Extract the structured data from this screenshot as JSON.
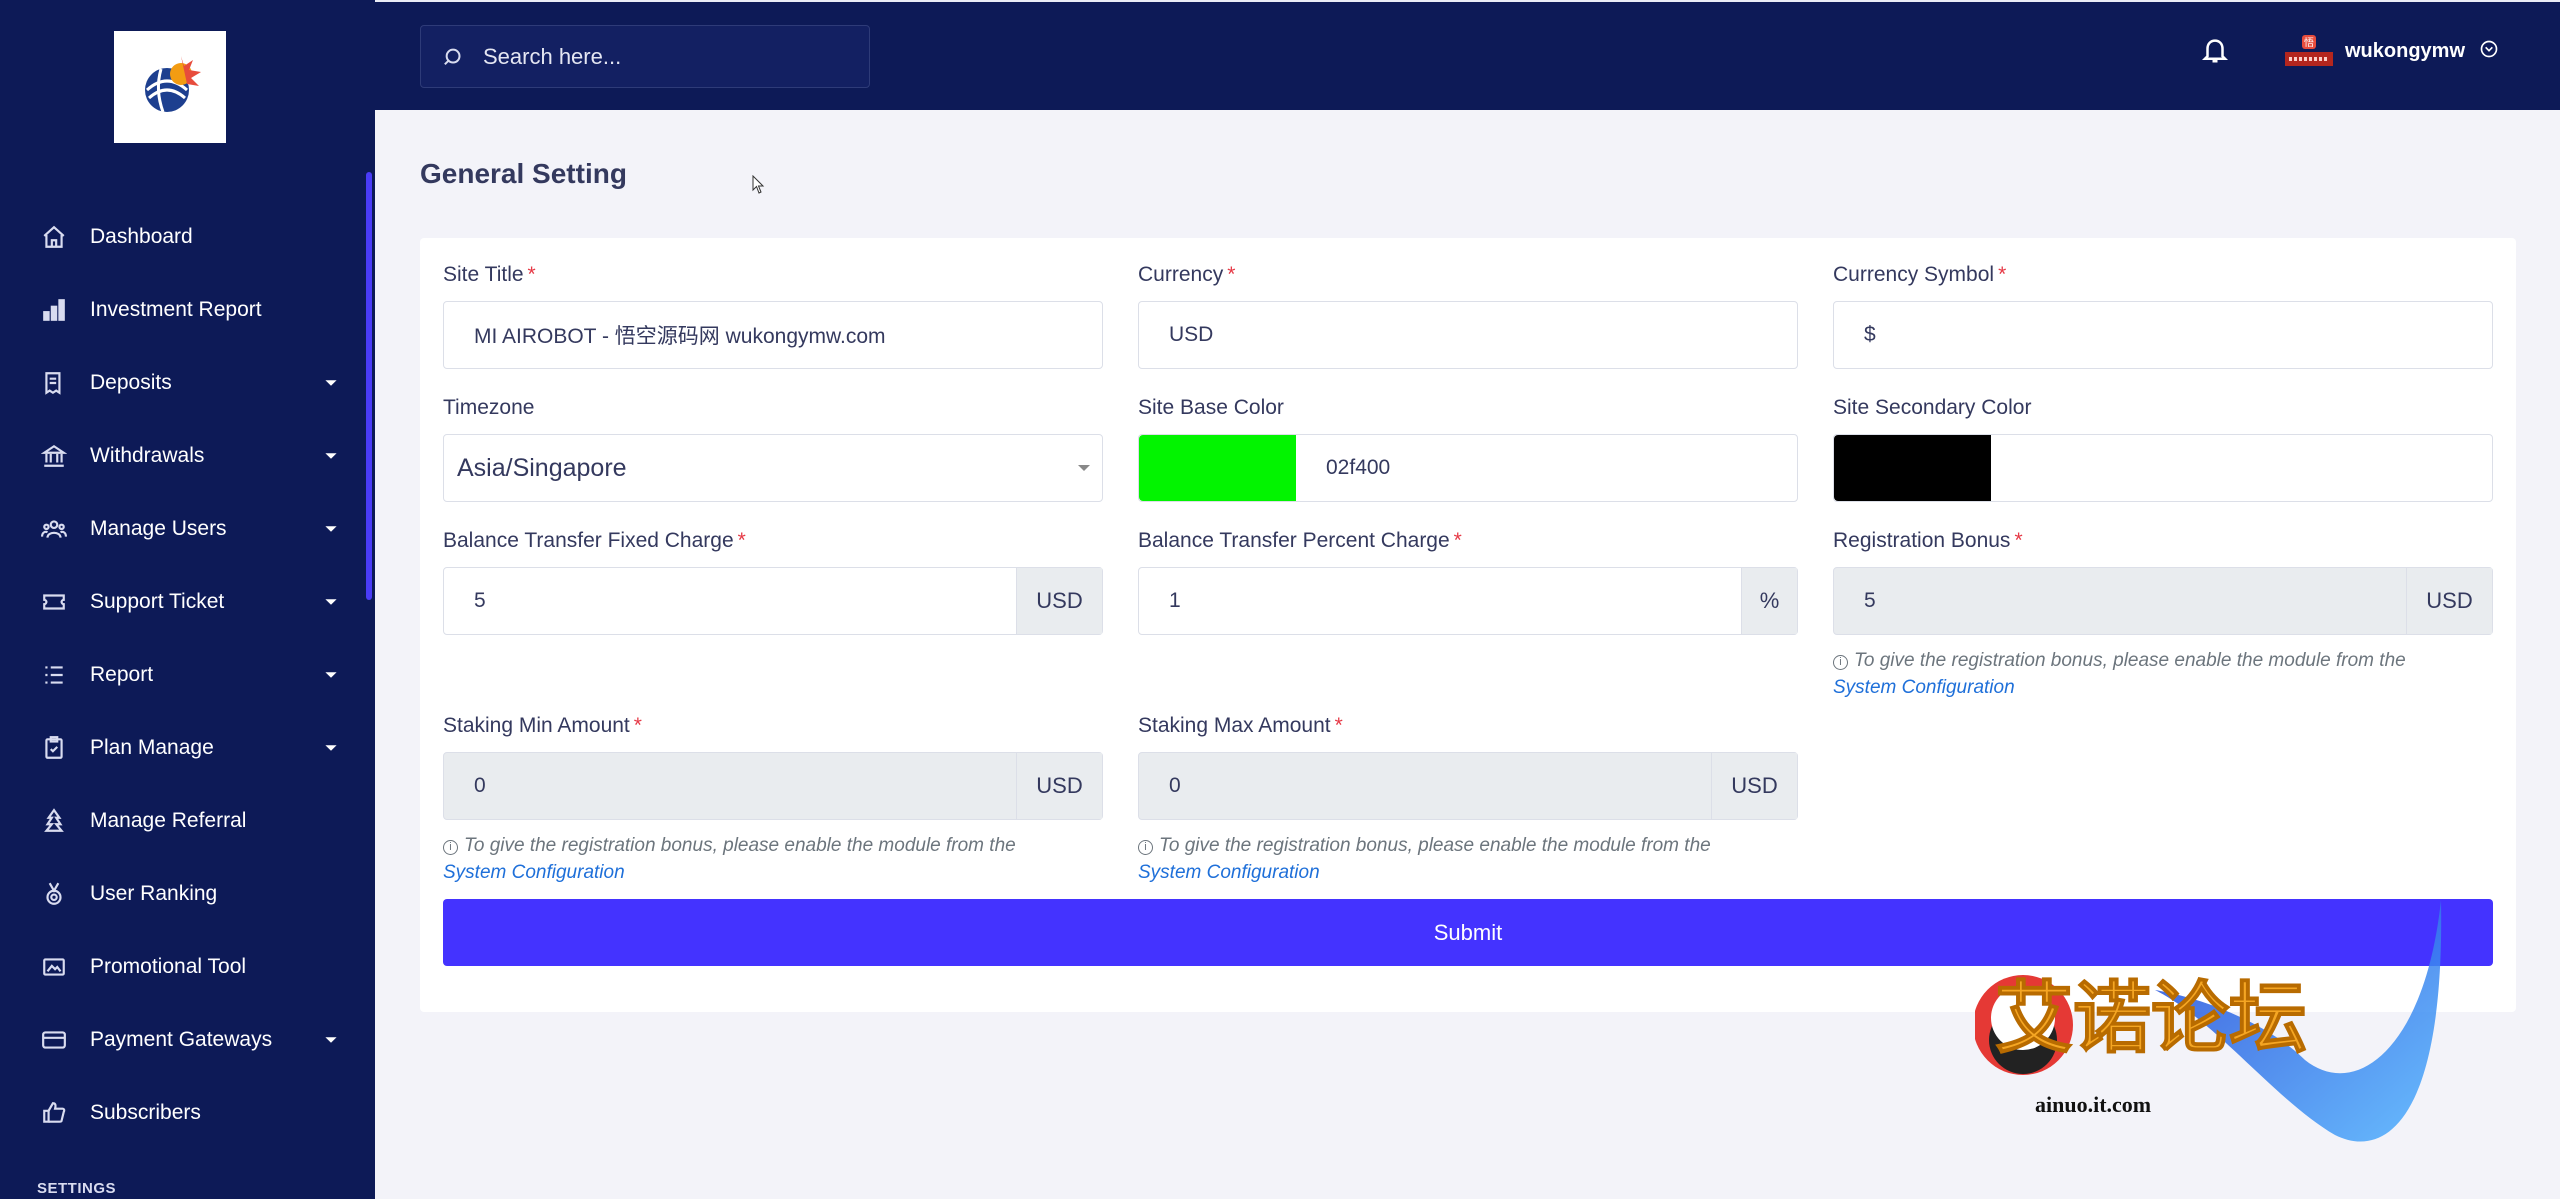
{
  "sidebar": {
    "items": [
      {
        "label": "Dashboard",
        "icon": "home-icon",
        "dropdown": false
      },
      {
        "label": "Investment Report",
        "icon": "bar-chart-icon",
        "dropdown": false
      },
      {
        "label": "Deposits",
        "icon": "receipt-icon",
        "dropdown": true
      },
      {
        "label": "Withdrawals",
        "icon": "bank-icon",
        "dropdown": true
      },
      {
        "label": "Manage Users",
        "icon": "users-icon",
        "dropdown": true
      },
      {
        "label": "Support Ticket",
        "icon": "ticket-icon",
        "dropdown": true
      },
      {
        "label": "Report",
        "icon": "list-icon",
        "dropdown": true
      },
      {
        "label": "Plan Manage",
        "icon": "clipboard-icon",
        "dropdown": true
      },
      {
        "label": "Manage Referral",
        "icon": "tree-icon",
        "dropdown": false
      },
      {
        "label": "User Ranking",
        "icon": "medal-icon",
        "dropdown": false
      },
      {
        "label": "Promotional Tool",
        "icon": "image-icon",
        "dropdown": false
      },
      {
        "label": "Payment Gateways",
        "icon": "credit-card-icon",
        "dropdown": true
      },
      {
        "label": "Subscribers",
        "icon": "thumbs-up-icon",
        "dropdown": false
      }
    ],
    "section_label": "SETTINGS"
  },
  "topbar": {
    "search_placeholder": "Search here...",
    "username": "wukongymw"
  },
  "page": {
    "title": "General Setting"
  },
  "form": {
    "site_title": {
      "label": "Site Title",
      "value": "MI AIROBOT - 悟空源码网 wukongymw.com"
    },
    "currency": {
      "label": "Currency",
      "value": "USD"
    },
    "currency_symbol": {
      "label": "Currency Symbol",
      "value": "$"
    },
    "timezone": {
      "label": "Timezone",
      "value": "Asia/Singapore"
    },
    "base_color": {
      "label": "Site Base Color",
      "value": "02f400",
      "swatch": "#02f400"
    },
    "secondary_color": {
      "label": "Site Secondary Color",
      "value": "",
      "swatch": "#000000"
    },
    "bt_fixed": {
      "label": "Balance Transfer Fixed Charge",
      "value": "5",
      "addon": "USD"
    },
    "bt_percent": {
      "label": "Balance Transfer Percent Charge",
      "value": "1",
      "addon": "%"
    },
    "reg_bonus": {
      "label": "Registration Bonus",
      "value": "5",
      "addon": "USD"
    },
    "staking_min": {
      "label": "Staking Min Amount",
      "value": "0",
      "addon": "USD"
    },
    "staking_max": {
      "label": "Staking Max Amount",
      "value": "0",
      "addon": "USD"
    },
    "note_text": "To give the registration bonus, please enable the module from the",
    "note_link": "System Configuration",
    "submit_label": "Submit"
  },
  "watermark": {
    "text": "艾诺论坛",
    "domain": "ainuo.it.com"
  },
  "colors": {
    "sidebar_bg": "#0d1a57",
    "accent": "#4433ff",
    "required": "#e63946",
    "link": "#1e6fd9"
  }
}
